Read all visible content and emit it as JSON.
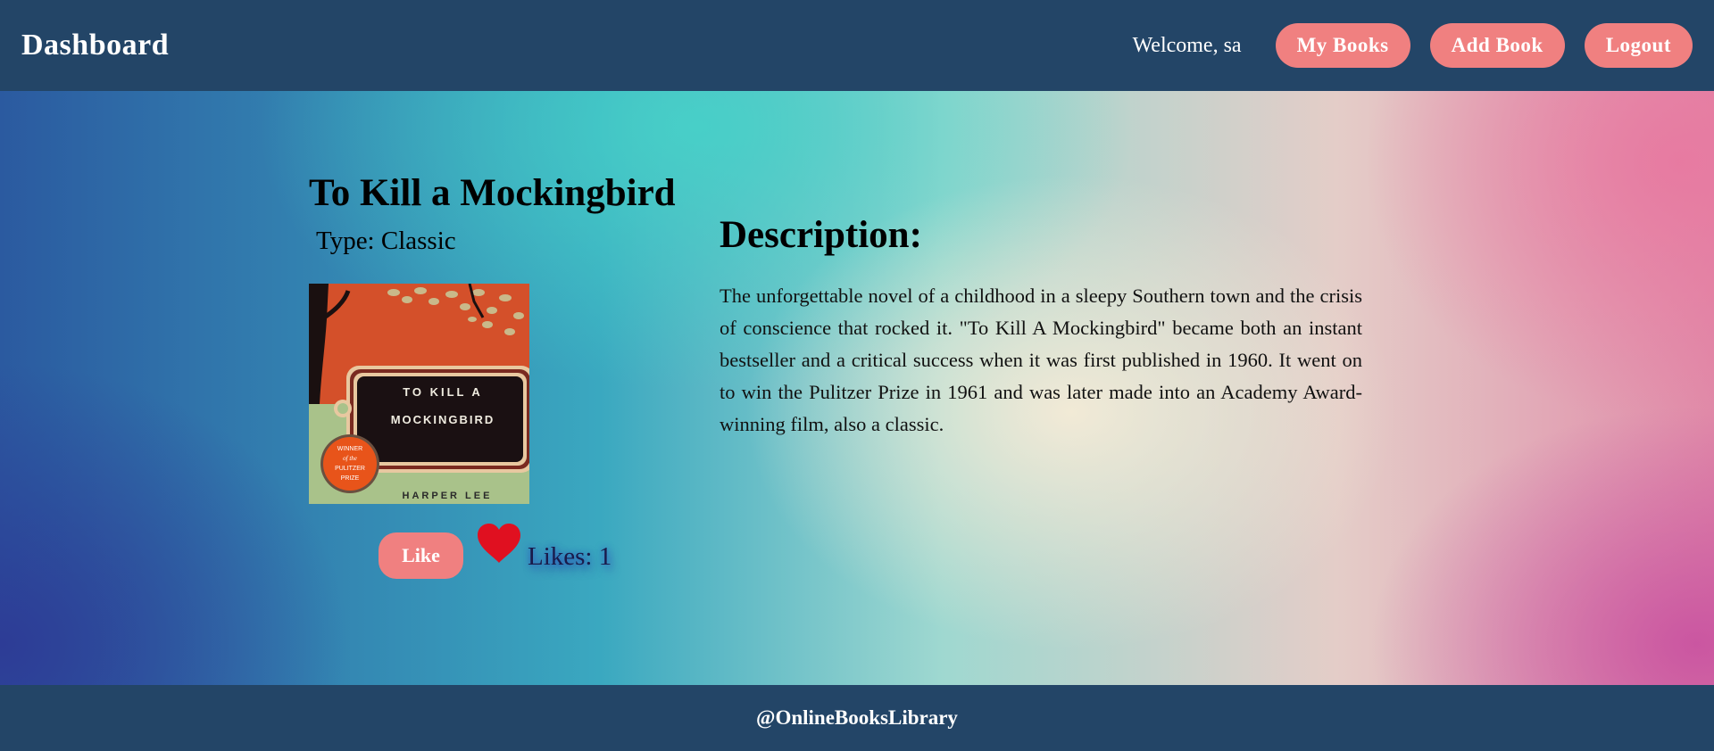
{
  "header": {
    "brand": "Dashboard",
    "welcome": "Welcome, sa",
    "nav": [
      {
        "label": "My Books"
      },
      {
        "label": "Add Book"
      },
      {
        "label": "Logout"
      }
    ]
  },
  "book": {
    "title": "To Kill a Mockingbird",
    "type": "Type: Classic",
    "cover": {
      "title_line1": "TO KILL A",
      "title_line2": "MOCKINGBIRD",
      "author": "HARPER LEE",
      "seal_lines": [
        "WINNER",
        "of the",
        "PULITZER",
        "PRIZE"
      ]
    },
    "like_label": "Like",
    "likes_text": "Likes: 1",
    "description_heading": "Description:",
    "description": "The unforgettable novel of a childhood in a sleepy Southern town and the crisis of conscience that rocked it. \"To Kill A Mockingbird\" became both an instant bestseller and a critical success when it was first published in 1960. It went on to win the Pulitzer Prize in 1961 and was later made into an Academy Award-winning film, also a classic."
  },
  "footer": {
    "text": "@OnlineBooksLibrary"
  },
  "colors": {
    "header_bg": "#234567",
    "button_bg": "#f08080",
    "heart": "#e01020"
  }
}
